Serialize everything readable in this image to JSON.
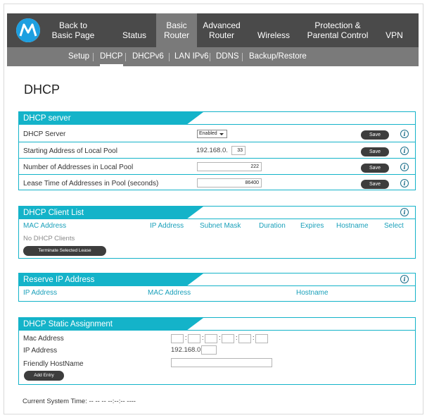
{
  "colors": {
    "accent": "#14b3c9",
    "nav_dark": "#4a4a4a",
    "nav_active": "#7a7a7a",
    "button": "#3d3d3d"
  },
  "nav": {
    "logo_icon": "motorola-logo-icon",
    "items": [
      {
        "l1": "Back to",
        "l2": "Basic Page"
      },
      {
        "l1": "",
        "l2": "Status"
      },
      {
        "l1": "Basic",
        "l2": "Router"
      },
      {
        "l1": "Advanced",
        "l2": "Router"
      },
      {
        "l1": "",
        "l2": "Wireless"
      },
      {
        "l1": "Protection &",
        "l2": "Parental Control"
      },
      {
        "l1": "",
        "l2": "VPN"
      }
    ]
  },
  "subnav": {
    "items": [
      "Setup",
      "DHCP",
      "DHCPv6",
      "LAN IPv6",
      "DDNS",
      "Backup/Restore"
    ]
  },
  "page": {
    "title": "DHCP"
  },
  "dhcp_server": {
    "title": "DHCP server",
    "save_label": "Save",
    "rows": {
      "server": {
        "label": "DHCP Server",
        "value": "Enabled"
      },
      "start": {
        "label": "Starting Address of Local Pool",
        "prefix": "192.168.0.",
        "value": "33"
      },
      "count": {
        "label": "Number of Addresses in Local Pool",
        "value": "222"
      },
      "lease": {
        "label": "Lease Time of Addresses in Pool (seconds)",
        "value": "86400"
      }
    }
  },
  "client_list": {
    "title": "DHCP Client List",
    "columns": [
      "MAC Address",
      "IP Address",
      "Subnet Mask",
      "Duration",
      "Expires",
      "Hostname",
      "Select"
    ],
    "empty_text": "No DHCP Clients",
    "terminate_label": "Terminate Selected Lease"
  },
  "reserve": {
    "title": "Reserve IP Address",
    "columns": [
      "IP Address",
      "MAC Address",
      "Hostname"
    ]
  },
  "static": {
    "title": "DHCP Static Assignment",
    "mac_label": "Mac Address",
    "ip_label": "IP Address",
    "ip_prefix": "192.168.0.",
    "hostname_label": "Friendly HostName",
    "add_label": "Add Entry"
  },
  "footer": {
    "system_time": "Current System Time: -- -- -- --:--:-- ----"
  }
}
